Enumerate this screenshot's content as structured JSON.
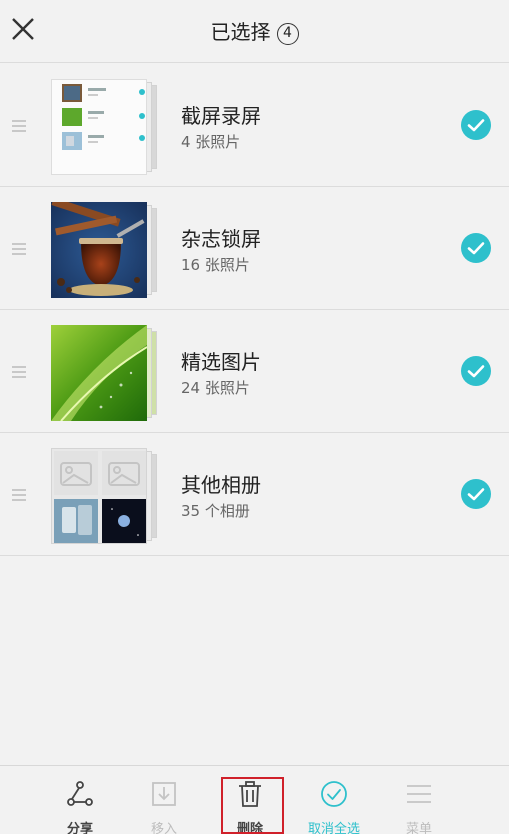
{
  "header": {
    "title": "已选择",
    "selected_count": "4"
  },
  "albums": [
    {
      "name": "截屏录屏",
      "count": "4 张照片",
      "thumb": "screenshots"
    },
    {
      "name": "杂志锁屏",
      "count": "16 张照片",
      "thumb": "tea"
    },
    {
      "name": "精选图片",
      "count": "24 张照片",
      "thumb": "leaf"
    },
    {
      "name": "其他相册",
      "count": "35 个相册",
      "thumb": "others"
    }
  ],
  "toolbar": {
    "share_label": "分享",
    "move_label": "移入",
    "delete_label": "删除",
    "deselect_all_label": "取消全选",
    "menu_label": "菜单"
  },
  "colors": {
    "accent": "#2ec0cc",
    "highlight": "#d0202a"
  }
}
